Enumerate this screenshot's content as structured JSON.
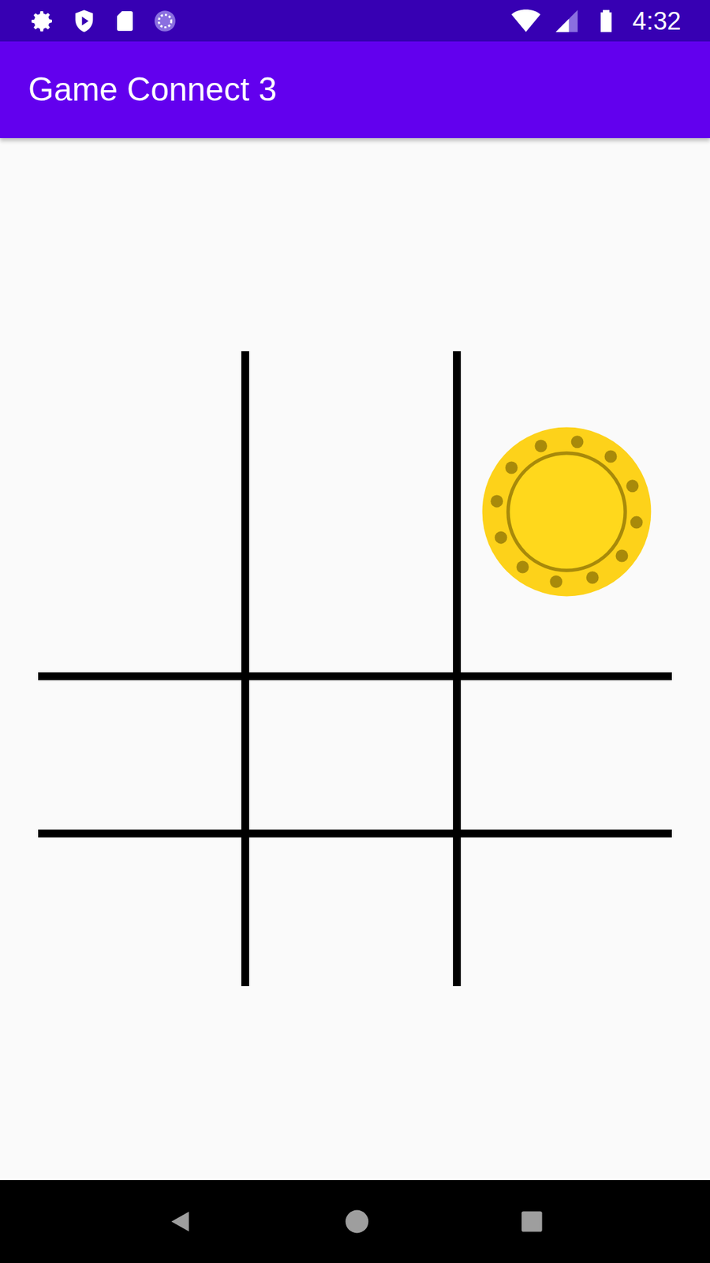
{
  "status_bar": {
    "time": "4:32"
  },
  "app_bar": {
    "title": "Game Connect 3"
  },
  "board": {
    "cells": [
      {
        "piece": "none"
      },
      {
        "piece": "none"
      },
      {
        "piece": "yellow"
      },
      {
        "piece": "none"
      },
      {
        "piece": "none"
      },
      {
        "piece": "none"
      },
      {
        "piece": "none"
      },
      {
        "piece": "none"
      },
      {
        "piece": "none"
      }
    ]
  }
}
